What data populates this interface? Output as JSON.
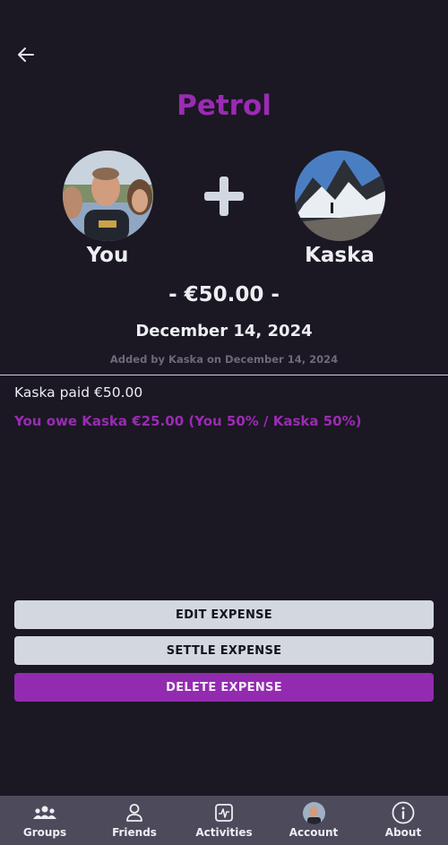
{
  "header": {
    "title": "Petrol"
  },
  "participants": {
    "you": {
      "name": "You"
    },
    "other": {
      "name": "Kaska"
    }
  },
  "expense": {
    "amount": "- €50.00 -",
    "date": "December 14, 2024",
    "added_by": "Added by Kaska on December 14, 2024",
    "paid_text": "Kaska paid €50.00",
    "owe_text": "You owe Kaska €25.00 (You 50% / Kaska 50%)"
  },
  "actions": {
    "edit": "EDIT EXPENSE",
    "settle": "SETTLE EXPENSE",
    "delete": "DELETE EXPENSE"
  },
  "nav": {
    "groups": "Groups",
    "friends": "Friends",
    "activities": "Activities",
    "account": "Account",
    "about": "About"
  },
  "colors": {
    "background": "#1b1723",
    "accent": "#9a2bb3",
    "nav_background": "#4d4a5c",
    "button_light": "#d2d7e0"
  }
}
